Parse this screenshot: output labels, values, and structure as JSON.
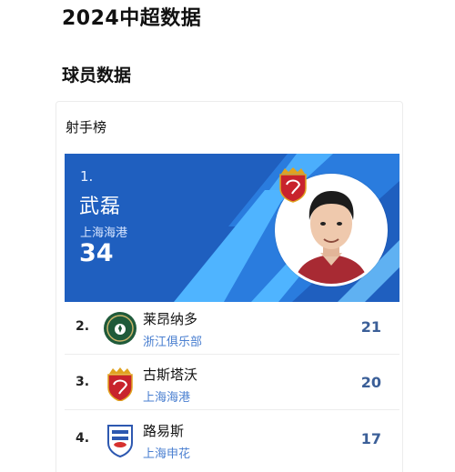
{
  "page": {
    "title": "2024中超数据",
    "section_title": "球员数据"
  },
  "scorers_card": {
    "title": "射手榜",
    "leader": {
      "rank": "1.",
      "name": "武磊",
      "club": "上海海港",
      "goals": "34"
    },
    "rows": [
      {
        "rank": "2.",
        "name": "莱昂纳多",
        "club": "浙江俱乐部",
        "goals": "21",
        "logo": "zhejiang-club-logo"
      },
      {
        "rank": "3.",
        "name": "古斯塔沃",
        "club": "上海海港",
        "goals": "20",
        "logo": "shanghai-port-logo"
      },
      {
        "rank": "4.",
        "name": "路易斯",
        "club": "上海申花",
        "goals": "17",
        "logo": "shanghai-shenhua-logo"
      }
    ]
  },
  "colors": {
    "hero_blue": "#1f5fbf",
    "hero_stripe": "#4fb4ff",
    "club_text": "#4a7fd0",
    "goals_text": "#3b5f98"
  }
}
